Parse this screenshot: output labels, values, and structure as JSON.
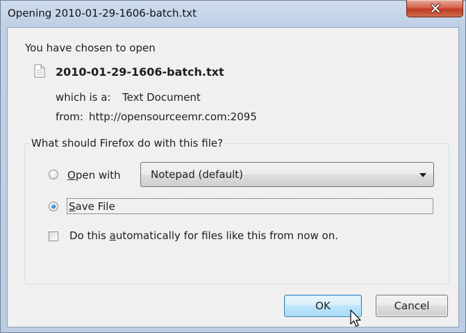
{
  "window": {
    "title": "Opening 2010-01-29-1606-batch.txt"
  },
  "intro": "You have chosen to open",
  "file": {
    "name": "2010-01-29-1606-batch.txt",
    "type_label": "which is a:",
    "type_value": "Text Document",
    "from_label": "from:",
    "from_value": "http://opensourceemr.com:2095"
  },
  "action_group": {
    "legend": "What should Firefox do with this file?",
    "open_with": {
      "label_mnemonic": "O",
      "label_rest": "pen with",
      "checked": false,
      "application": "Notepad (default)"
    },
    "save_file": {
      "label_mnemonic": "S",
      "label_rest": "ave File",
      "checked": true
    },
    "auto_checkbox": {
      "label_pre": "Do this ",
      "label_mnemonic": "a",
      "label_post": "utomatically for files like this from now on.",
      "checked": false
    }
  },
  "buttons": {
    "ok_label": "OK",
    "cancel_label": "Cancel"
  },
  "colors": {
    "title_bar": "#bfd0e6",
    "client_bg": "#f0f0f0",
    "close_button": "#c13c24",
    "ok_border": "#3c7fb1",
    "radio_selected": "#1a64b8"
  },
  "icons": {
    "close": "close-icon",
    "document": "text-document-icon",
    "dropdown": "chevron-down-icon",
    "cursor": "mouse-pointer-icon"
  }
}
